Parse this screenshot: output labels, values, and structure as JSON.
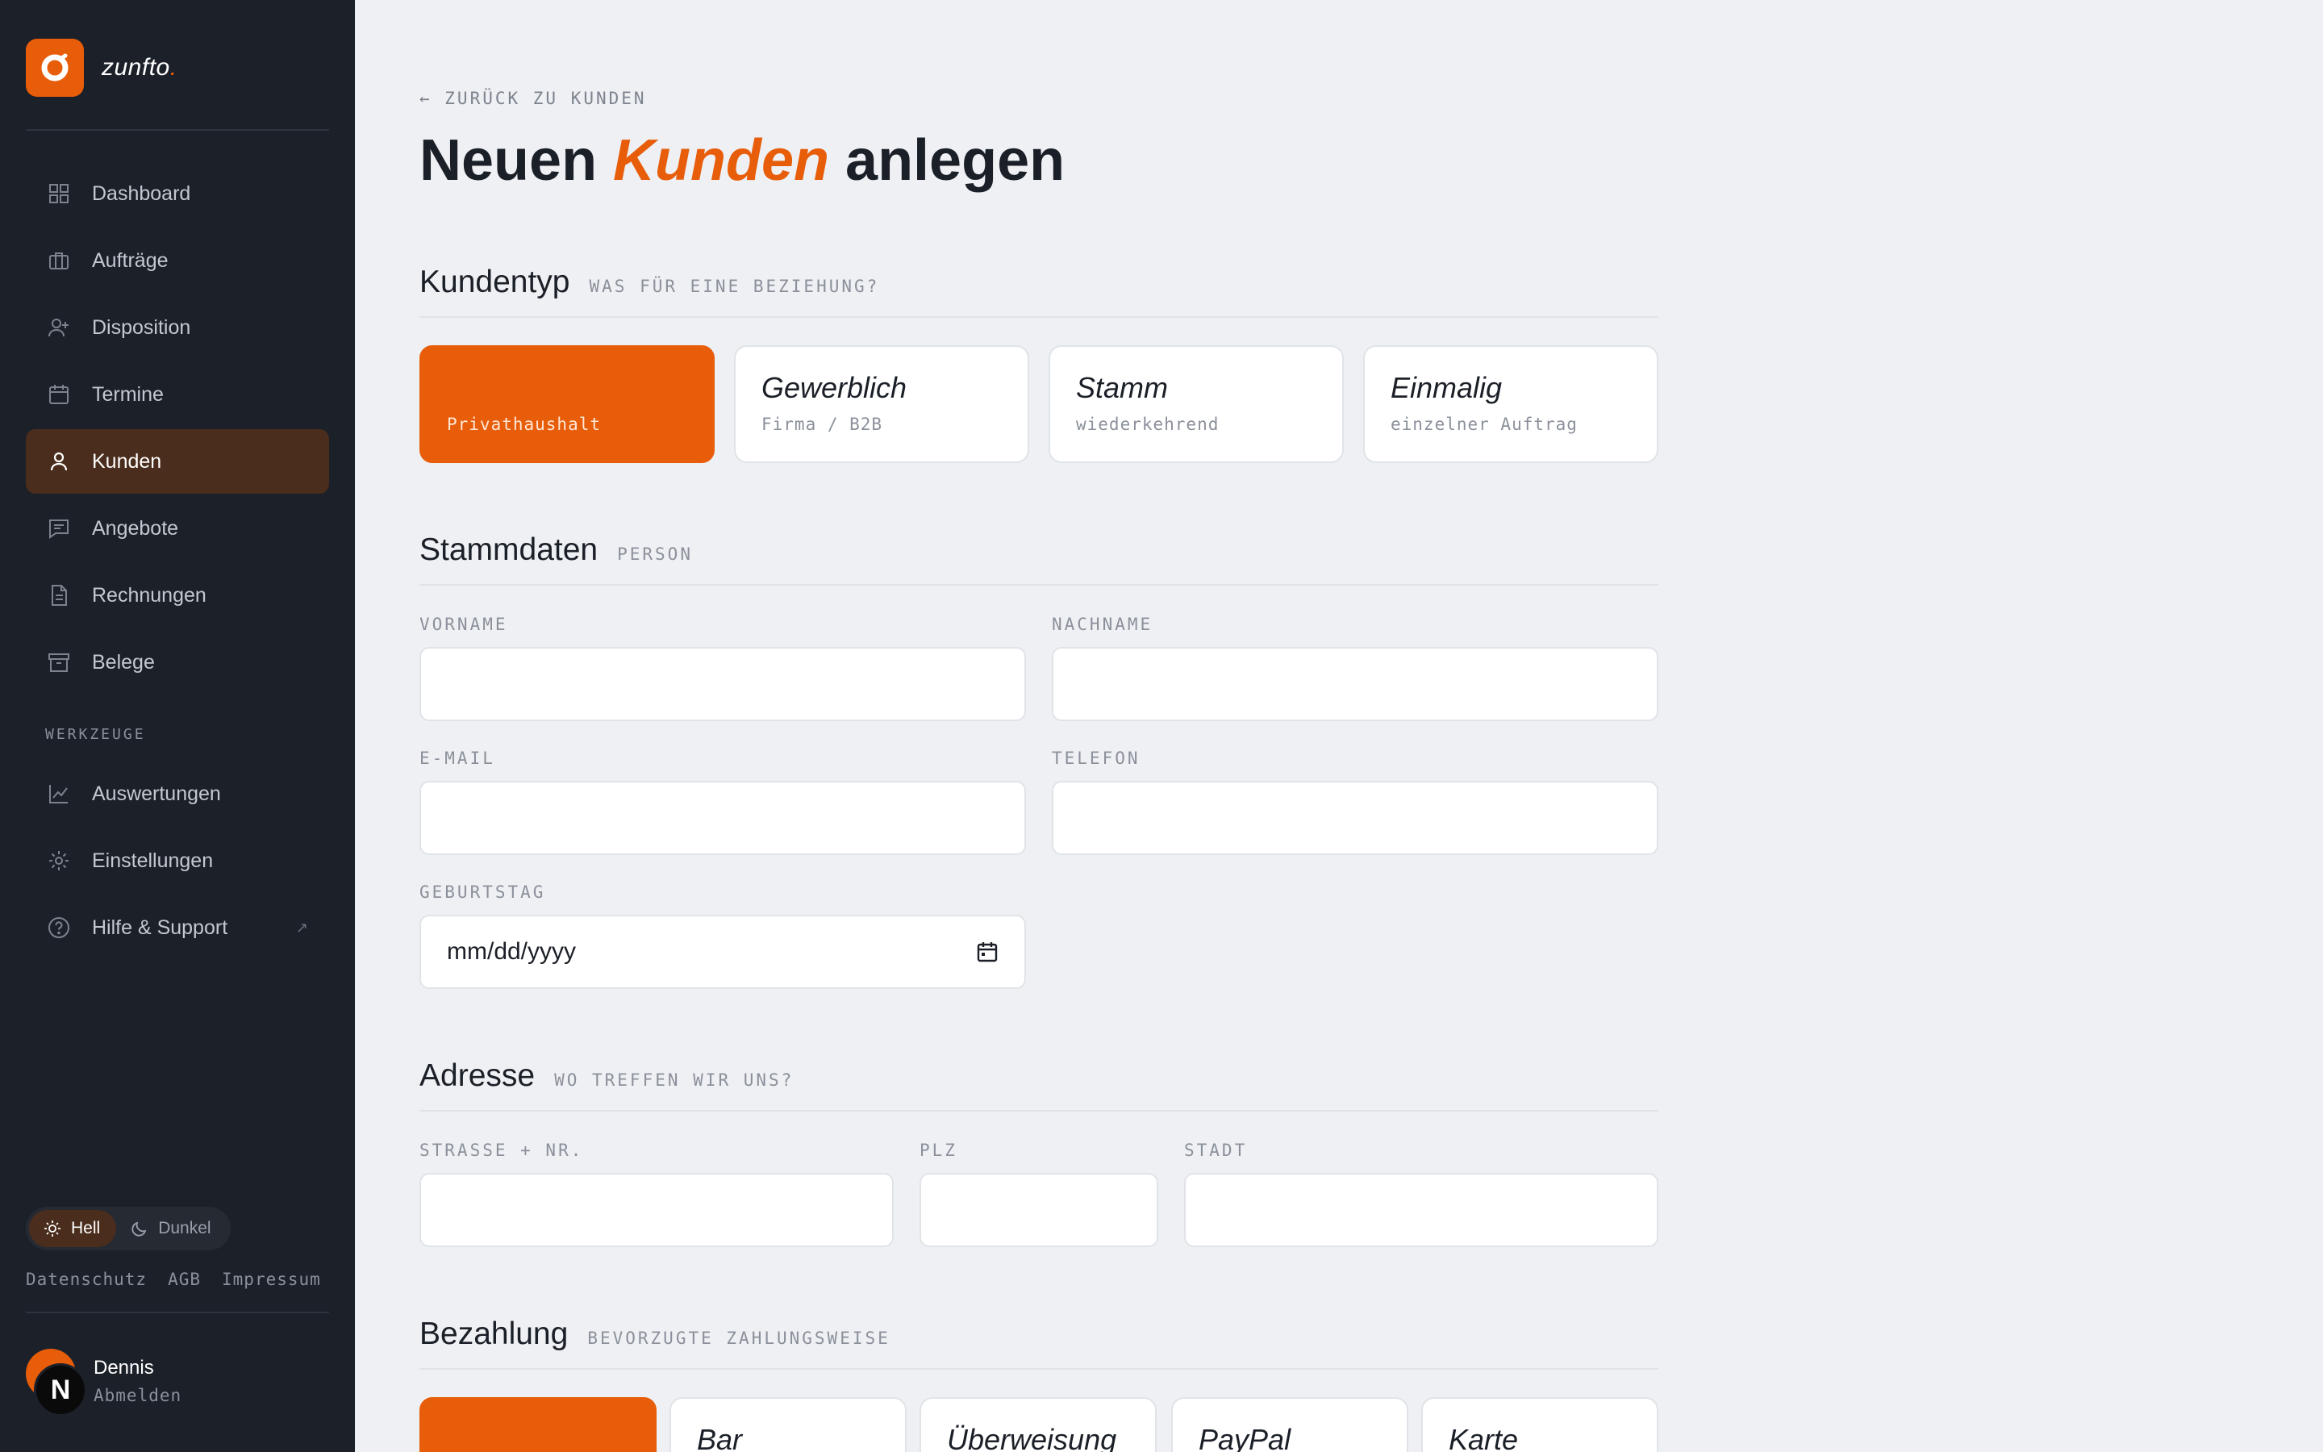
{
  "brand": {
    "name": "zunfto",
    "dot": ".",
    "accent": "#e85d0a"
  },
  "sidebar": {
    "items": [
      {
        "label": "Dashboard",
        "icon": "grid-icon"
      },
      {
        "label": "Aufträge",
        "icon": "briefcase-icon"
      },
      {
        "label": "Disposition",
        "icon": "user-plus-icon"
      },
      {
        "label": "Termine",
        "icon": "calendar-icon"
      },
      {
        "label": "Kunden",
        "icon": "user-icon",
        "active": true
      },
      {
        "label": "Angebote",
        "icon": "message-icon"
      },
      {
        "label": "Rechnungen",
        "icon": "document-icon"
      },
      {
        "label": "Belege",
        "icon": "archive-icon"
      }
    ],
    "tools_label": "WERKZEUGE",
    "tools": [
      {
        "label": "Auswertungen",
        "icon": "chart-icon"
      },
      {
        "label": "Einstellungen",
        "icon": "gear-icon"
      },
      {
        "label": "Hilfe & Support",
        "icon": "help-icon",
        "external": "↗"
      }
    ],
    "theme": {
      "light": "Hell",
      "dark": "Dunkel",
      "selected": "light"
    },
    "legal": [
      "Datenschutz",
      "AGB",
      "Impressum"
    ],
    "user": {
      "name": "Dennis",
      "initial": "N",
      "logout": "Abmelden"
    }
  },
  "page": {
    "back_link": "← ZURÜCK ZU KUNDEN",
    "title_before": "Neuen ",
    "title_accent": "Kunden",
    "title_after": " anlegen"
  },
  "kundentyp": {
    "title": "Kundentyp",
    "subtitle": "WAS FÜR EINE BEZIEHUNG?",
    "options": [
      {
        "title": "",
        "sub": "Privathaushalt",
        "selected": true
      },
      {
        "title": "Gewerblich",
        "sub": "Firma / B2B"
      },
      {
        "title": "Stamm",
        "sub": "wiederkehrend"
      },
      {
        "title": "Einmalig",
        "sub": "einzelner Auftrag"
      }
    ]
  },
  "stammdaten": {
    "title": "Stammdaten",
    "subtitle": "PERSON",
    "fields": {
      "vorname": {
        "label": "VORNAME",
        "value": ""
      },
      "nachname": {
        "label": "NACHNAME",
        "value": ""
      },
      "email": {
        "label": "E-MAIL",
        "value": ""
      },
      "telefon": {
        "label": "TELEFON",
        "value": ""
      },
      "geburtstag": {
        "label": "GEBURTSTAG",
        "value": "mm/dd/yyyy"
      }
    }
  },
  "adresse": {
    "title": "Adresse",
    "subtitle": "WO TREFFEN WIR UNS?",
    "fields": {
      "strasse": {
        "label": "STRASSE + NR.",
        "value": ""
      },
      "plz": {
        "label": "PLZ",
        "value": ""
      },
      "stadt": {
        "label": "STADT",
        "value": ""
      }
    }
  },
  "bezahlung": {
    "title": "Bezahlung",
    "subtitle": "BEVORZUGTE ZAHLUNGSWEISE",
    "options": [
      {
        "title": "",
        "selected": true
      },
      {
        "title": "Bar"
      },
      {
        "title": "Überweisung"
      },
      {
        "title": "PayPal"
      },
      {
        "title": "Karte"
      }
    ]
  }
}
